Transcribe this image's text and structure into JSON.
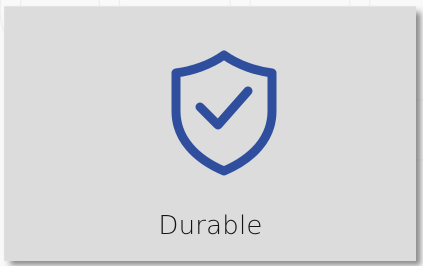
{
  "card": {
    "label": "Durable",
    "icon": "shield-check-icon"
  },
  "colors": {
    "accent": "#2f4f9e",
    "card_background": "#dcdcdc",
    "text": "#141414"
  }
}
